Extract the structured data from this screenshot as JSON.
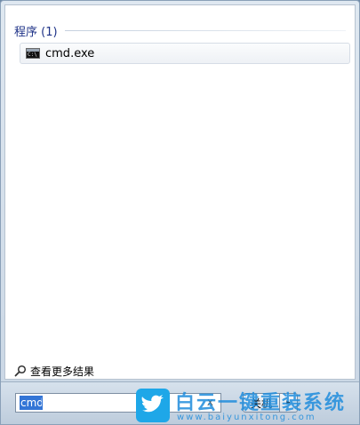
{
  "results": {
    "group_title": "程序 (1)",
    "items": [
      {
        "label": "cmd.exe",
        "icon": "cmd-console-icon"
      }
    ],
    "see_more_label": "查看更多结果"
  },
  "search": {
    "value": "cmd",
    "clear_icon": "x"
  },
  "shutdown": {
    "label": "关机",
    "arrow": "▸"
  },
  "watermark": {
    "title": "白云一键重装系统",
    "url": "www.baiyunxitong.com"
  },
  "colors": {
    "group_title": "#1e3287",
    "selection": "#3375d6",
    "watermark": "#1e8cdc"
  }
}
